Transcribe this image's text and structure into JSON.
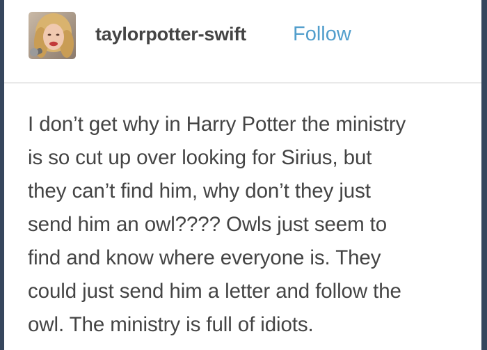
{
  "post": {
    "author": {
      "username": "taylorpotter-swift",
      "follow_label": "Follow",
      "avatar_icon": "user-avatar"
    },
    "body_lines": [
      "I don’t get why in Harry Potter the ministry",
      "is so cut up over looking for Sirius, but",
      "they can’t find him, why don’t they just",
      "send him an owl???? Owls just seem to",
      "find and know where everyone is. They",
      "could just send him a letter and follow the",
      "owl. The ministry is full of idiots."
    ]
  },
  "colors": {
    "background": "#36465d",
    "card": "#ffffff",
    "text": "#444444",
    "link": "#529ecc",
    "divider": "#e9e9e9"
  }
}
